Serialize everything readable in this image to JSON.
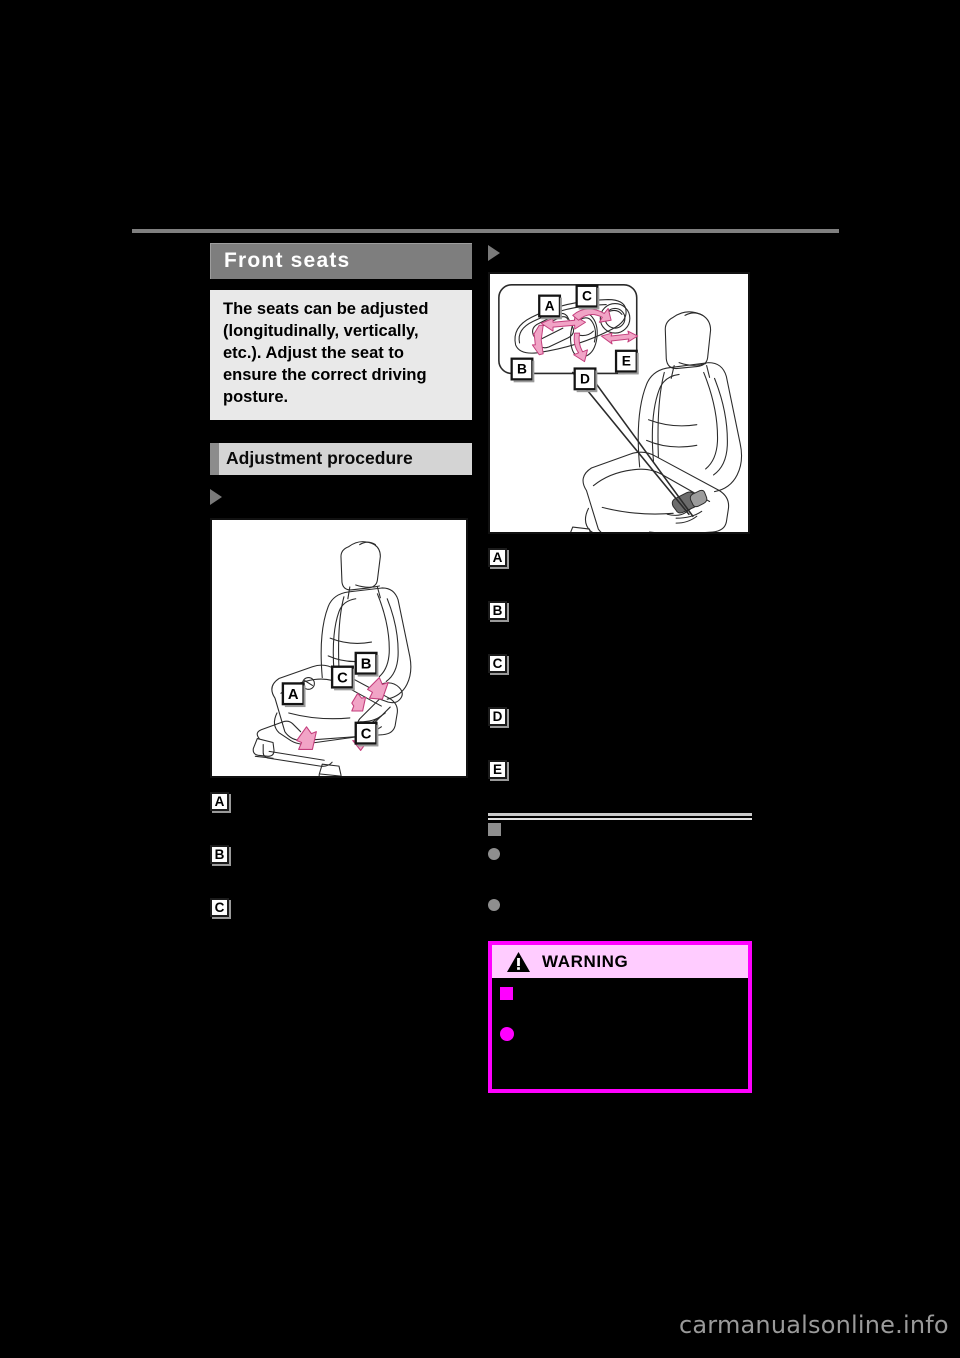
{
  "document": {
    "type": "vehicle owner's manual page",
    "background_color": "#000000",
    "page_rule_color": "#7f7f7f"
  },
  "left_column": {
    "section_header": {
      "label": "Front seats",
      "bg_color": "#7e7e7e",
      "text_color": "#ffffff"
    },
    "description": {
      "text": "The seats can be adjusted (longitudinally, vertically, etc.). Adjust the seat to ensure the correct driving posture.",
      "bg_color": "#e9e9e9"
    },
    "subsection_header": {
      "label": "Adjustment procedure",
      "bg_color": "#d4d4d4",
      "tab_color": "#8c8c8c"
    },
    "variant_marker": {
      "icon": "triangle-right-icon",
      "label": ""
    },
    "figure": {
      "name": "manual-seat-adjustment-diagram",
      "alt": "Driver seat side view with lettered adjustment callouts",
      "callout_letters": [
        "A",
        "B",
        "C",
        "C"
      ],
      "arrow_color": "#f2a3c4"
    },
    "callouts": [
      {
        "letter": "A",
        "text": ""
      },
      {
        "letter": "B",
        "text": ""
      },
      {
        "letter": "C",
        "text": ""
      }
    ]
  },
  "right_column": {
    "variant_marker": {
      "icon": "triangle-right-icon",
      "label": ""
    },
    "figure": {
      "name": "power-seat-switch-diagram",
      "alt": "Power seat control switches inset with seat side view",
      "callout_letters": [
        "A",
        "B",
        "C",
        "D",
        "E"
      ],
      "arrow_color": "#f2a3c4"
    },
    "callouts": [
      {
        "letter": "A",
        "text": ""
      },
      {
        "letter": "B",
        "text": ""
      },
      {
        "letter": "C",
        "text": ""
      },
      {
        "letter": "D",
        "text": ""
      },
      {
        "letter": "E",
        "text": ""
      }
    ],
    "notes_section": {
      "heading": "",
      "bullet_color": "#8e8e8e",
      "items": [
        {
          "text": ""
        },
        {
          "text": ""
        }
      ]
    },
    "warning": {
      "title": "WARNING",
      "icon": "warning-triangle-icon",
      "border_color": "#ff00ff",
      "header_bg": "#ffccff",
      "items": [
        {
          "bullet": "square",
          "text": ""
        },
        {
          "bullet": "circle",
          "text": ""
        }
      ]
    }
  },
  "footer": {
    "watermark": "carmanualsonline.info",
    "color": "#9a9a9a"
  }
}
